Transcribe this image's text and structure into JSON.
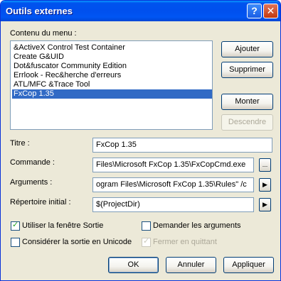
{
  "window": {
    "title": "Outils externes",
    "help": "?",
    "close": "✕"
  },
  "menu": {
    "label": "Contenu du menu :",
    "items": [
      "&ActiveX Control Test Container",
      "Create G&UID",
      "Dot&fuscator Community Edition",
      "Errlook - Rec&herche d'erreurs",
      "ATL/MFC &Trace Tool",
      "FxCop 1.35"
    ],
    "selected_index": 5
  },
  "buttons": {
    "ajouter": "Ajouter",
    "supprimer": "Supprimer",
    "monter": "Monter",
    "descendre": "Descendre",
    "ok": "OK",
    "annuler": "Annuler",
    "appliquer": "Appliquer",
    "browse": "...",
    "arrow": "▶"
  },
  "fields": {
    "titre": {
      "label": "Titre :",
      "value": "FxCop 1.35"
    },
    "commande": {
      "label": "Commande :",
      "value": "Files\\Microsoft FxCop 1.35\\FxCopCmd.exe"
    },
    "arguments": {
      "label": "Arguments :",
      "value": "ogram Files\\Microsoft FxCop 1.35\\Rules\" /c"
    },
    "repertoire": {
      "label": "Répertoire initial :",
      "value": "$(ProjectDir)"
    }
  },
  "options": {
    "sortie": {
      "label": "Utiliser la fenêtre Sortie",
      "checked": true
    },
    "demander": {
      "label": "Demander les arguments",
      "checked": false
    },
    "unicode": {
      "label": "Considérer la sortie en Unicode",
      "checked": false
    },
    "fermer": {
      "label": "Fermer en quittant",
      "checked": true,
      "disabled": true
    }
  },
  "check_glyph": "✓"
}
